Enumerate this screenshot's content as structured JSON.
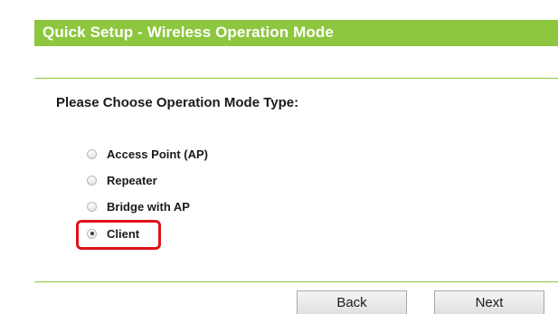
{
  "header": {
    "title": "Quick Setup - Wireless Operation Mode"
  },
  "prompt": "Please Choose Operation Mode Type:",
  "options": [
    {
      "label": "Access Point (AP)",
      "checked": false
    },
    {
      "label": "Repeater",
      "checked": false
    },
    {
      "label": "Bridge with AP",
      "checked": false
    },
    {
      "label": "Client",
      "checked": true
    }
  ],
  "buttons": {
    "back": "Back",
    "next": "Next"
  },
  "colors": {
    "accent_green": "#8dc63f",
    "highlight_red": "#e0121b"
  }
}
